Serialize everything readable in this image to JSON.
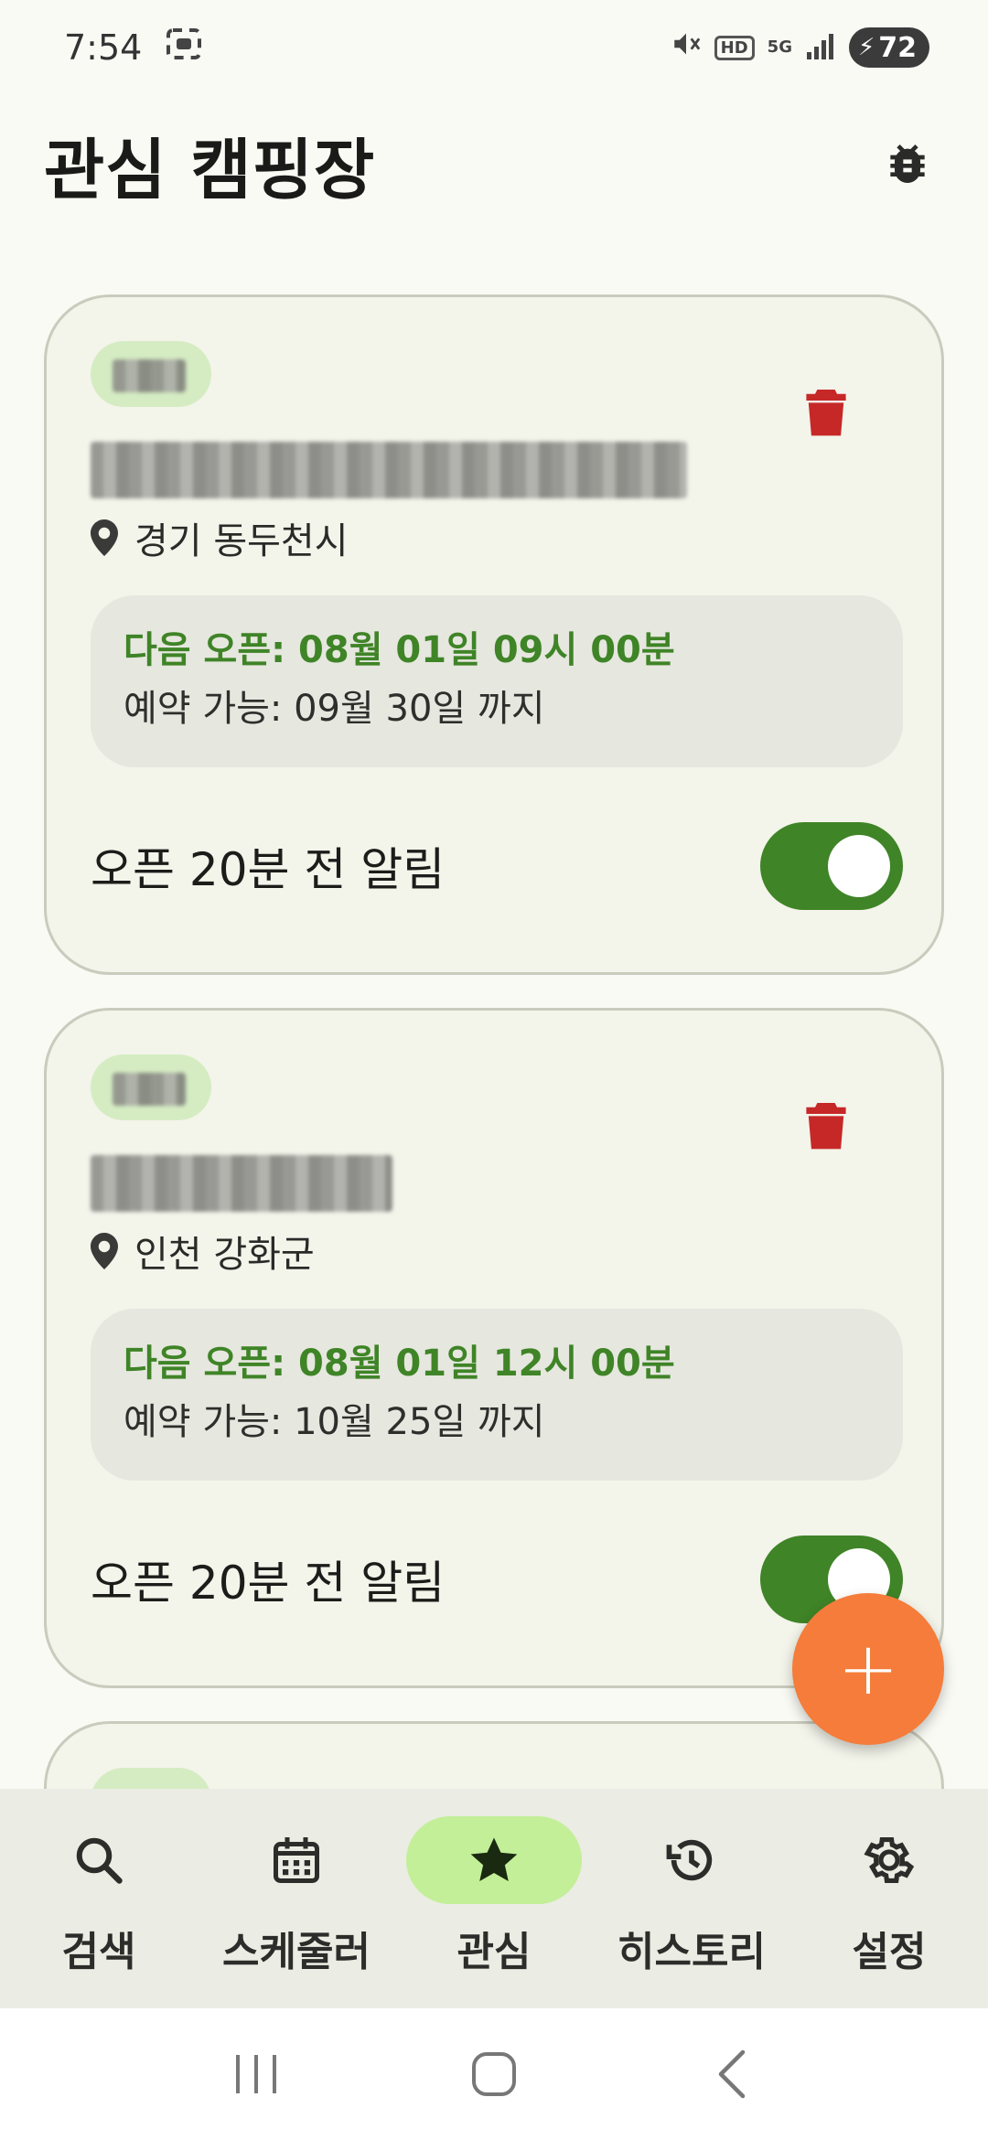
{
  "status_bar": {
    "time": "7:54",
    "network": "5G",
    "hd": "HD",
    "battery": "72"
  },
  "header": {
    "title": "관심 캠핑장"
  },
  "cards": [
    {
      "location": "경기 동두천시",
      "next_open": "다음 오픈: 08월 01일 09시 00분",
      "available": "예약 가능: 09월 30일 까지",
      "alert_label": "오픈 20분 전 알림",
      "alert_on": true
    },
    {
      "location": "인천 강화군",
      "next_open": "다음 오픈: 08월 01일 12시 00분",
      "available": "예약 가능: 10월 25일 까지",
      "alert_label": "오픈 20분 전 알림",
      "alert_on": true
    }
  ],
  "fab": {
    "label": "+"
  },
  "bottom_nav": {
    "items": [
      {
        "label": "검색",
        "icon": "search-icon"
      },
      {
        "label": "스케줄러",
        "icon": "calendar-icon"
      },
      {
        "label": "관심",
        "icon": "star-icon",
        "active": true
      },
      {
        "label": "히스토리",
        "icon": "history-icon"
      },
      {
        "label": "설정",
        "icon": "settings-icon"
      }
    ]
  },
  "colors": {
    "accent_green": "#3f8427",
    "fab_orange": "#f57c3a",
    "delete_red": "#c62828",
    "active_nav": "#c2ef98"
  }
}
